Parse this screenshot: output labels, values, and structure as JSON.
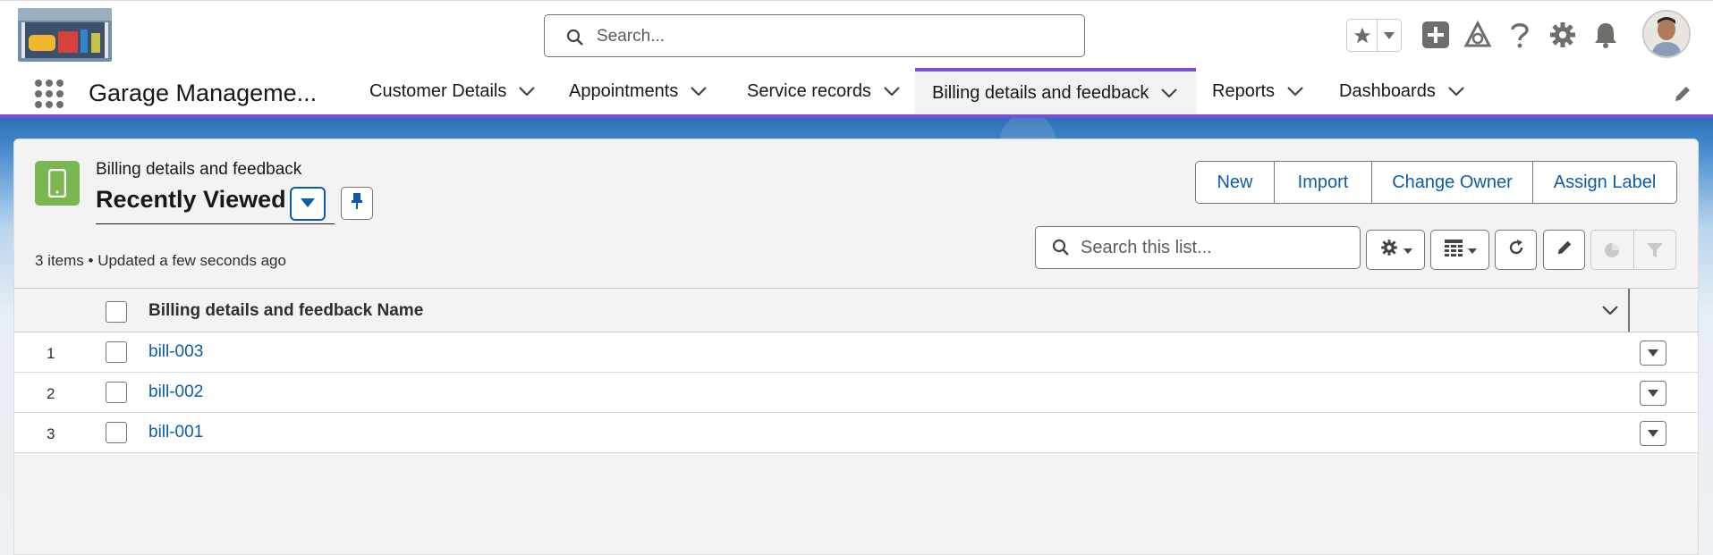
{
  "header": {
    "search_placeholder": "Search...",
    "icons": [
      "star-icon",
      "chevron-down-icon",
      "add-icon",
      "trailhead-icon",
      "help-icon",
      "setup-gear-icon",
      "notification-bell-icon"
    ]
  },
  "nav": {
    "app_name": "Garage Manageme...",
    "items": [
      {
        "label": "Customer Details"
      },
      {
        "label": "Appointments"
      },
      {
        "label": "Service records"
      },
      {
        "label": "Billing details and feedback",
        "active": true
      },
      {
        "label": "Reports"
      },
      {
        "label": "Dashboards"
      }
    ]
  },
  "list_view": {
    "object_label": "Billing details and feedback",
    "view_name": "Recently Viewed",
    "meta": "3 items • Updated a few seconds ago",
    "buttons": [
      "New",
      "Import",
      "Change Owner",
      "Assign Label"
    ],
    "search_placeholder": "Search this list..."
  },
  "table": {
    "column_header": "Billing details and feedback Name",
    "rows": [
      {
        "num": "1",
        "name": "bill-003"
      },
      {
        "num": "2",
        "name": "bill-002"
      },
      {
        "num": "3",
        "name": "bill-001"
      }
    ]
  },
  "colors": {
    "brand_blue": "#0b5cab",
    "nav_accent": "#7b4fd5",
    "object_icon": "#7bb651"
  }
}
